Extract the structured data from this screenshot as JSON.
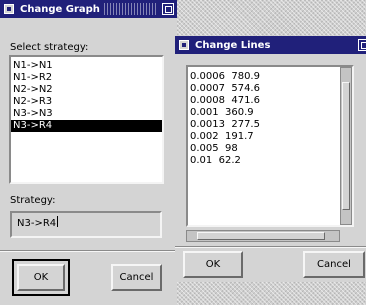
{
  "change_graph": {
    "title": "Change Graph",
    "select_label": "Select strategy:",
    "strategies": [
      "N1->N1",
      "N1->R2",
      "N2->N2",
      "N2->R3",
      "N3->N3",
      "N3->R4"
    ],
    "selected_index": 5,
    "strategy_label": "Strategy:",
    "strategy_value": "N3->R4",
    "ok_label": "OK",
    "cancel_label": "Cancel"
  },
  "change_lines": {
    "title": "Change Lines",
    "rows": [
      "0.0006  780.9",
      "0.0007  574.6",
      "0.0008  471.6",
      "0.001  360.9",
      "0.0013  277.5",
      "0.002  191.7",
      "0.005  98",
      "0.01  62.2"
    ],
    "ok_label": "OK",
    "cancel_label": "Cancel"
  }
}
